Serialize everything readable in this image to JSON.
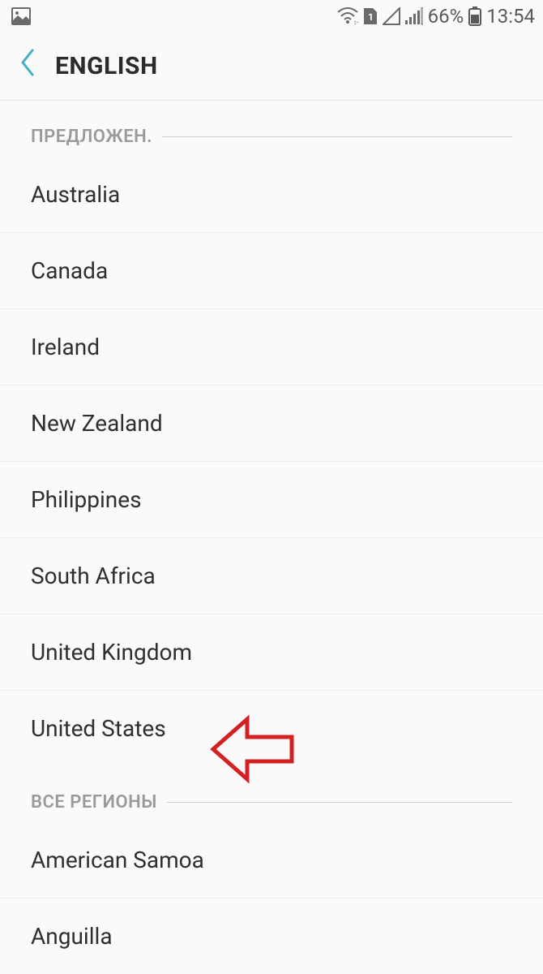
{
  "status_bar": {
    "battery_pct": "66%",
    "time": "13:54"
  },
  "header": {
    "title": "ENGLISH"
  },
  "sections": {
    "suggested_label": "ПРЕДЛОЖЕН.",
    "all_regions_label": "ВСЕ РЕГИОНЫ"
  },
  "suggested_items": [
    "Australia",
    "Canada",
    "Ireland",
    "New Zealand",
    "Philippines",
    "South Africa",
    "United Kingdom",
    "United States"
  ],
  "all_region_items": [
    "American Samoa",
    "Anguilla"
  ]
}
